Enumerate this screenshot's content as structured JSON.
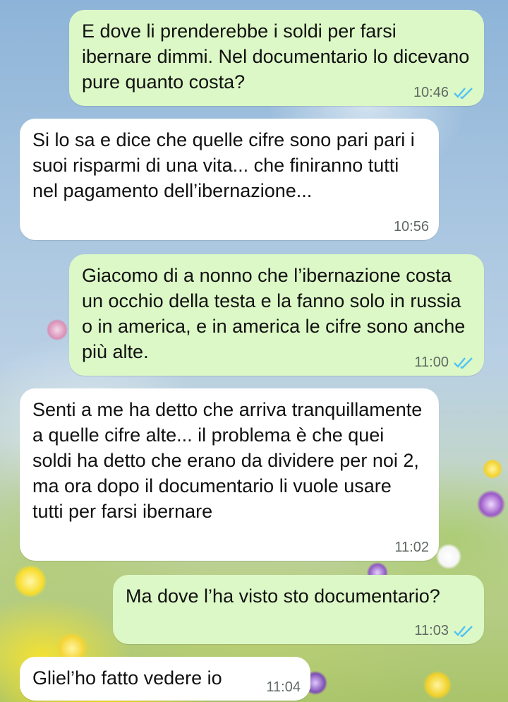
{
  "messages": [
    {
      "direction": "out",
      "text": "E dove li prenderebbe i soldi per farsi ibernare dimmi. Nel documentario lo dicevano pure quanto costa?",
      "time": "10:46",
      "read": true
    },
    {
      "direction": "in",
      "text": "Si lo sa e dice che quelle cifre sono pari pari i suoi risparmi di una vita... che finiranno tutti nel pagamento dell’ibernazione...",
      "time": "10:56"
    },
    {
      "direction": "out",
      "text": "Giacomo di a nonno che l’ibernazione costa un occhio della testa e la fanno solo in russia o in america, e in america le cifre sono anche più alte.",
      "time": "11:00",
      "read": true
    },
    {
      "direction": "in",
      "text": "Senti a me ha detto che arriva tranquillamente a quelle cifre alte... il problema è che quei soldi ha detto che erano da dividere per noi 2, ma ora dopo il documentario li vuole usare tutti per farsi ibernare",
      "time": "11:02"
    },
    {
      "direction": "out",
      "text": "Ma dove l’ha visto sto documentario?",
      "time": "11:03",
      "read": true
    },
    {
      "direction": "in",
      "text": "Gliel’ho fatto vedere io",
      "time": "11:04"
    }
  ],
  "colors": {
    "outgoing_bubble": "#dcf8c6",
    "incoming_bubble": "#ffffff",
    "read_ticks": "#4fc3f7",
    "timestamp": "#5f6a63"
  },
  "icons": {
    "read_receipt": "double-check-icon"
  }
}
